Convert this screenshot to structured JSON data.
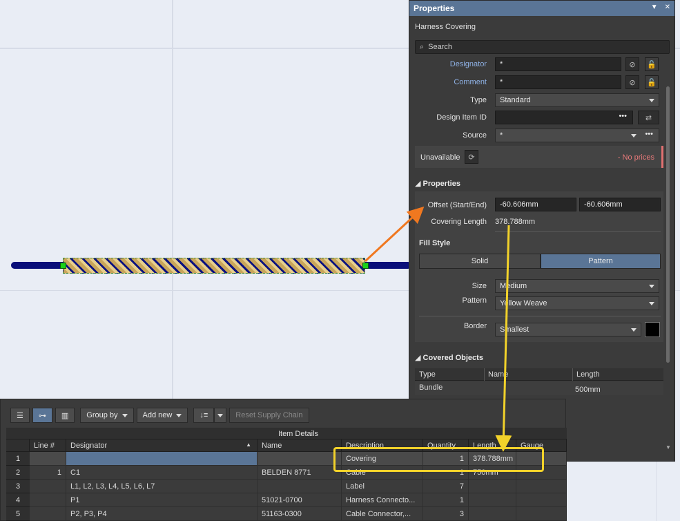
{
  "properties_panel": {
    "title": "Properties",
    "subtitle": "Harness Covering",
    "search_placeholder": "Search",
    "designator": {
      "label": "Designator",
      "value": "*"
    },
    "comment": {
      "label": "Comment",
      "value": "*"
    },
    "type": {
      "label": "Type",
      "value": "Standard"
    },
    "design_item_id": {
      "label": "Design Item ID",
      "value": ""
    },
    "source": {
      "label": "Source",
      "value": "*"
    },
    "supply": {
      "status": "Unavailable",
      "prices": "- No prices"
    },
    "section_properties": "Properties",
    "offset": {
      "label": "Offset (Start/End)",
      "start": "-60.606mm",
      "end": "-60.606mm"
    },
    "covering_length": {
      "label": "Covering Length",
      "value": "378.788mm"
    },
    "fill_style": {
      "label": "Fill Style",
      "options": [
        "Solid",
        "Pattern"
      ],
      "selected": "Pattern"
    },
    "size": {
      "label": "Size",
      "value": "Medium"
    },
    "pattern": {
      "label": "Pattern",
      "value": "Yellow Weave"
    },
    "border": {
      "label": "Border",
      "value": "Smallest",
      "color": "#000000"
    },
    "section_covered": "Covered Objects",
    "covered_table": {
      "headers": [
        "Type",
        "Name",
        "Length"
      ],
      "rows": [
        {
          "type": "Bundle",
          "name": "",
          "length": "500mm"
        }
      ]
    }
  },
  "bom": {
    "toolbar": {
      "group_by": "Group by",
      "add_new": "Add new",
      "reset": "Reset Supply Chain"
    },
    "group_header": "Item Details",
    "headers": [
      "Line #",
      "Designator",
      "Name",
      "Description",
      "Quantity",
      "Length",
      "Gauge"
    ],
    "rows": [
      {
        "n": "1",
        "line": "",
        "designator": "",
        "name": "",
        "description": "Covering",
        "quantity": "1",
        "length": "378.788mm",
        "gauge": ""
      },
      {
        "n": "2",
        "line": "1",
        "designator": "C1",
        "name": "BELDEN 8771",
        "description": "Cable",
        "quantity": "1",
        "length": "750mm",
        "gauge": ""
      },
      {
        "n": "3",
        "line": "",
        "designator": "L1, L2, L3, L4, L5, L6, L7",
        "name": "",
        "description": "Label",
        "quantity": "7",
        "length": "",
        "gauge": ""
      },
      {
        "n": "4",
        "line": "",
        "designator": "P1",
        "name": "51021-0700",
        "description": "Harness Connecto...",
        "quantity": "1",
        "length": "",
        "gauge": ""
      },
      {
        "n": "5",
        "line": "",
        "designator": "P2, P3, P4",
        "name": "51163-0300",
        "description": "Cable Connector,...",
        "quantity": "3",
        "length": "",
        "gauge": ""
      }
    ]
  },
  "colors": {
    "accent": "#5a7596",
    "highlight": "#f2d22a",
    "arrow": "#f07820",
    "wire": "#0a0f7a"
  }
}
